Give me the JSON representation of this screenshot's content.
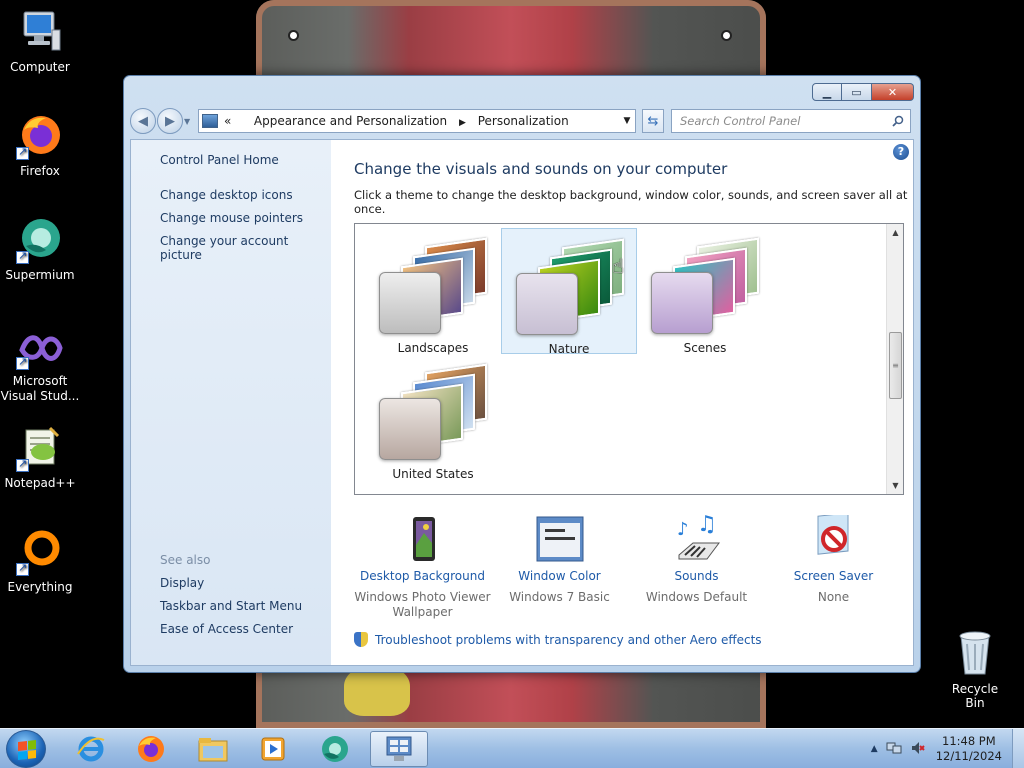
{
  "desktop": {
    "icons": [
      {
        "label": "Computer",
        "icon": "computer-icon"
      },
      {
        "label": "Firefox",
        "icon": "firefox-icon"
      },
      {
        "label": "Supermium",
        "icon": "supermium-icon"
      },
      {
        "label": "Microsoft Visual Stud...",
        "icon": "visual-studio-icon"
      },
      {
        "label": "Notepad++",
        "icon": "notepadpp-icon"
      },
      {
        "label": "Everything",
        "icon": "everything-icon"
      }
    ],
    "recycle_bin": "Recycle Bin"
  },
  "window": {
    "address": {
      "prefix": "«",
      "crumbs": [
        "Appearance and Personalization",
        "Personalization"
      ]
    },
    "search_placeholder": "Search Control Panel",
    "left_pane": {
      "home": "Control Panel Home",
      "links": [
        "Change desktop icons",
        "Change mouse pointers",
        "Change your account picture"
      ],
      "see_also_header": "See also",
      "see_also": [
        "Display",
        "Taskbar and Start Menu",
        "Ease of Access Center"
      ]
    },
    "main": {
      "title": "Change the visuals and sounds on your computer",
      "subtitle": "Click a theme to change the desktop background, window color, sounds, and screen saver all at once.",
      "themes": [
        {
          "name": "Landscapes",
          "selected": false
        },
        {
          "name": "Nature",
          "selected": true
        },
        {
          "name": "Scenes",
          "selected": false
        },
        {
          "name": "United States",
          "selected": false
        }
      ],
      "settings": [
        {
          "name": "Desktop Background",
          "value": "Windows Photo Viewer Wallpaper",
          "icon": "desktop-background-icon"
        },
        {
          "name": "Window Color",
          "value": "Windows 7 Basic",
          "icon": "window-color-icon"
        },
        {
          "name": "Sounds",
          "value": "Windows Default",
          "icon": "sounds-icon"
        },
        {
          "name": "Screen Saver",
          "value": "None",
          "icon": "screen-saver-icon"
        }
      ],
      "troubleshoot": "Troubleshoot problems with transparency and other Aero effects"
    }
  },
  "taskbar": {
    "time": "11:48 PM",
    "date": "12/11/2024"
  },
  "colors": {
    "link": "#1e5aa8",
    "heading": "#1e3b62",
    "taskbar": "#9ebfe4"
  }
}
